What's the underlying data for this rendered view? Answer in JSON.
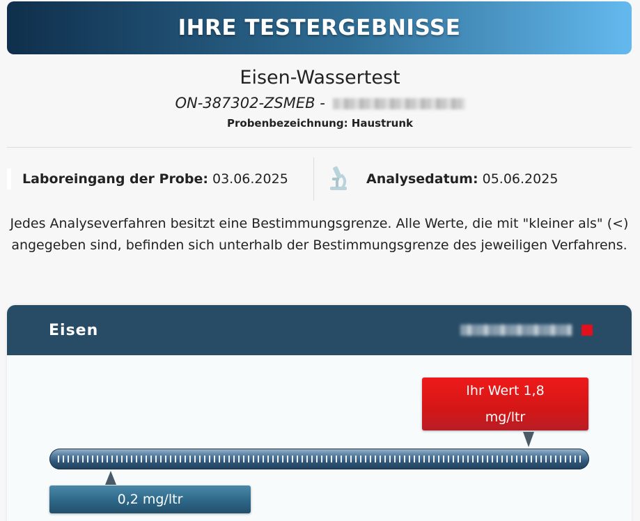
{
  "header": {
    "title": "IHRE TESTERGEBNISSE"
  },
  "test": {
    "name": "Eisen-Wassertest",
    "order_id": "ON-387302-ZSMEB -",
    "sample_label": "Probenbezeichnung: Haustrunk"
  },
  "dates": {
    "lab_entry_label": "Laboreingang der Probe:",
    "lab_entry_value": "03.06.2025",
    "analysis_label": "Analysedatum:",
    "analysis_value": "05.06.2025",
    "analysis_icon": "microscope-icon"
  },
  "info_text": "Jedes Analyseverfahren besitzt eine Bestimmungsgrenze. Alle Werte, die mit \"kleiner als\" (<) angegeben sind, befinden sich unterhalb der Bestimmungsgrenze des jeweiligen Verfahrens.",
  "result": {
    "parameter": "Eisen",
    "status_color": "#e0101c",
    "value_line1": "Ihr Wert 1,8",
    "value_line2": "mg/ltr",
    "value_color": "#e31717",
    "limit_label": "0,2 mg/ltr",
    "limit_color": "#2f6a8b"
  },
  "colors": {
    "header_gradient_start": "#0f2f4c",
    "header_gradient_end": "#63b9ee",
    "card_header": "#284c66"
  }
}
